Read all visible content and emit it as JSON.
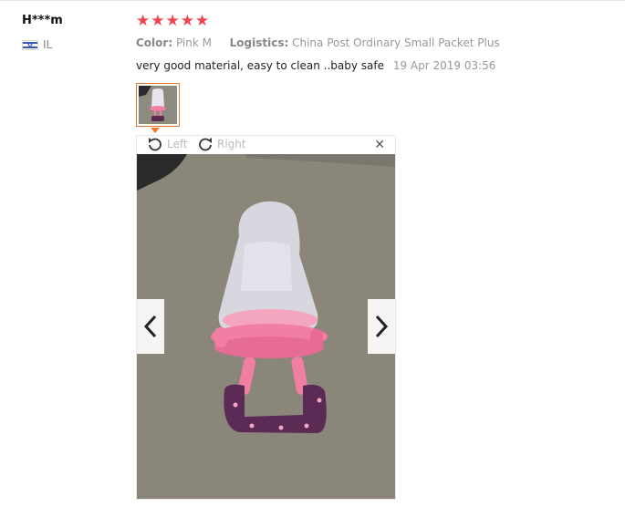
{
  "review": {
    "username": "H***m",
    "country": "IL",
    "rating": 5,
    "color_label": "Color:",
    "color_value": "Pink M",
    "logistics_label": "Logistics:",
    "logistics_value": "China Post Ordinary Small Packet Plus",
    "text": "very good material, easy to clean ..baby safe",
    "date": "19 Apr 2019 03:56"
  },
  "viewer": {
    "rotate_left_label": "Left",
    "rotate_right_label": "Right",
    "close_symbol": "✕"
  },
  "icons": {
    "star": "star-icon",
    "rotate_left": "rotate-left-icon",
    "rotate_right": "rotate-right-icon",
    "close": "close-icon",
    "prev": "chevron-left-icon",
    "next": "chevron-right-icon",
    "flag": "israel-flag-icon"
  },
  "colors": {
    "star": "#f0444d",
    "thumb_border": "#e07a3c",
    "muted_text": "#999999"
  }
}
